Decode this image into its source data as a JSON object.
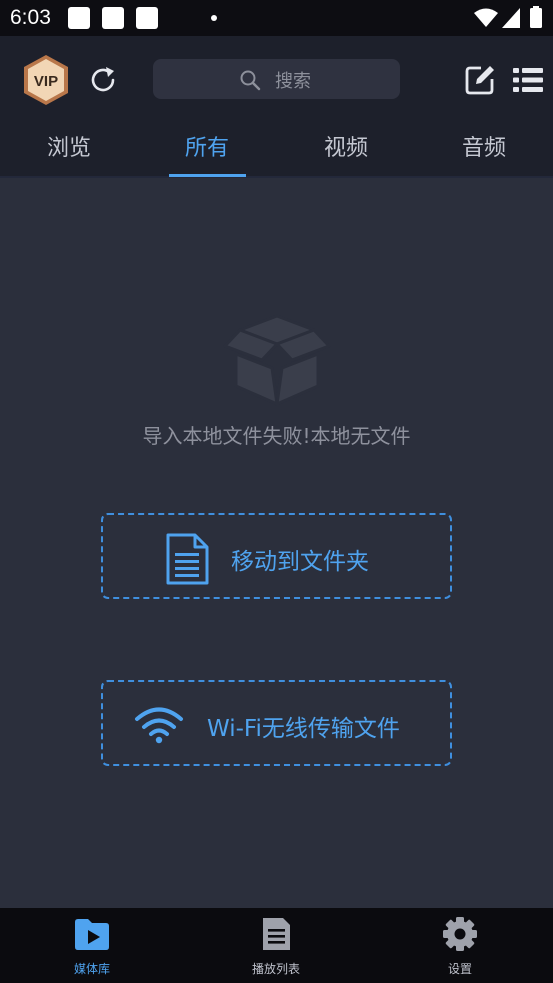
{
  "status_bar": {
    "time": "6:03"
  },
  "header": {
    "vip_badge": "VIP",
    "search_placeholder": "搜索"
  },
  "tabs": [
    {
      "label": "浏览",
      "active": false
    },
    {
      "label": "所有",
      "active": true
    },
    {
      "label": "视频",
      "active": false
    },
    {
      "label": "音频",
      "active": false
    }
  ],
  "content": {
    "empty_message": "导入本地文件失败!本地无文件",
    "move_to_folder": "移动到文件夹",
    "wifi_transfer": "Wi-Fi无线传输文件"
  },
  "bottom_nav": [
    {
      "label": "媒体库",
      "icon": "media-library-icon",
      "active": true
    },
    {
      "label": "播放列表",
      "icon": "playlist-icon",
      "active": false
    },
    {
      "label": "设置",
      "icon": "settings-icon",
      "active": false
    }
  ],
  "colors": {
    "accent": "#4fa3ef",
    "background": "#2b2f3c",
    "header": "#1d202b"
  }
}
